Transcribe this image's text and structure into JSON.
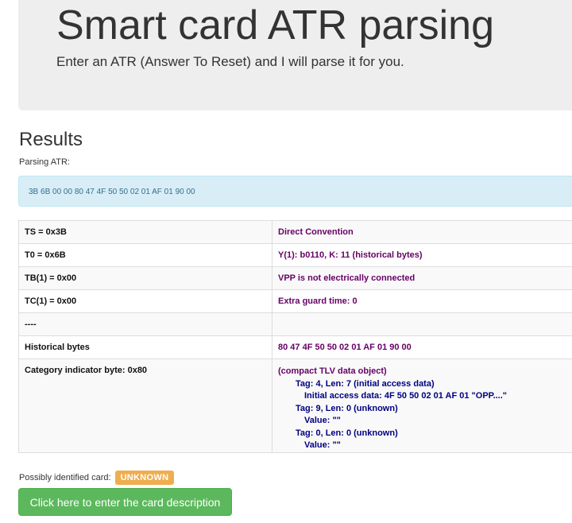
{
  "header": {
    "title": "Smart card ATR parsing",
    "subtitle": "Enter an ATR (Answer To Reset) and I will parse it for you."
  },
  "results": {
    "heading": "Results",
    "parsing_label": "Parsing ATR:",
    "atr_value": "3B 6B 00 00 80 47 4F 50 50 02 01 AF 01 90 00"
  },
  "table": {
    "rows": [
      {
        "key": "TS = 0x3B",
        "value": "Direct Convention"
      },
      {
        "key": "T0 = 0x6B",
        "value": "Y(1): b0110, K: 11 (historical bytes)"
      },
      {
        "key": "TB(1) = 0x00",
        "value": "VPP is not electrically connected"
      },
      {
        "key": "TC(1) = 0x00",
        "value": "Extra guard time: 0"
      },
      {
        "key": "----",
        "value": ""
      },
      {
        "key": "Historical bytes",
        "value": "80 47 4F 50 50 02 01 AF 01 90 00"
      }
    ],
    "category": {
      "key": "Category indicator byte: 0x80",
      "lines": [
        "(compact TLV data object)",
        "Tag: 4, Len: 7 (initial access data)",
        "Initial access data: 4F 50 50 02 01 AF 01 \"OPP....\"",
        "Tag: 9, Len: 0 (unknown)",
        "Value: \"\"",
        "Tag: 0, Len: 0 (unknown)",
        "Value: \"\""
      ]
    }
  },
  "identification": {
    "label": "Possibly identified card:",
    "badge": "UNKNOWN"
  },
  "actions": {
    "enter_description_label": "Click here to enter the card description"
  },
  "colors": {
    "badge_warning": "#f0ad4e",
    "button_success": "#5cb85c",
    "info_box": "#d9edf7",
    "value_purple": "#660066",
    "tlv_navy": "#000080"
  }
}
